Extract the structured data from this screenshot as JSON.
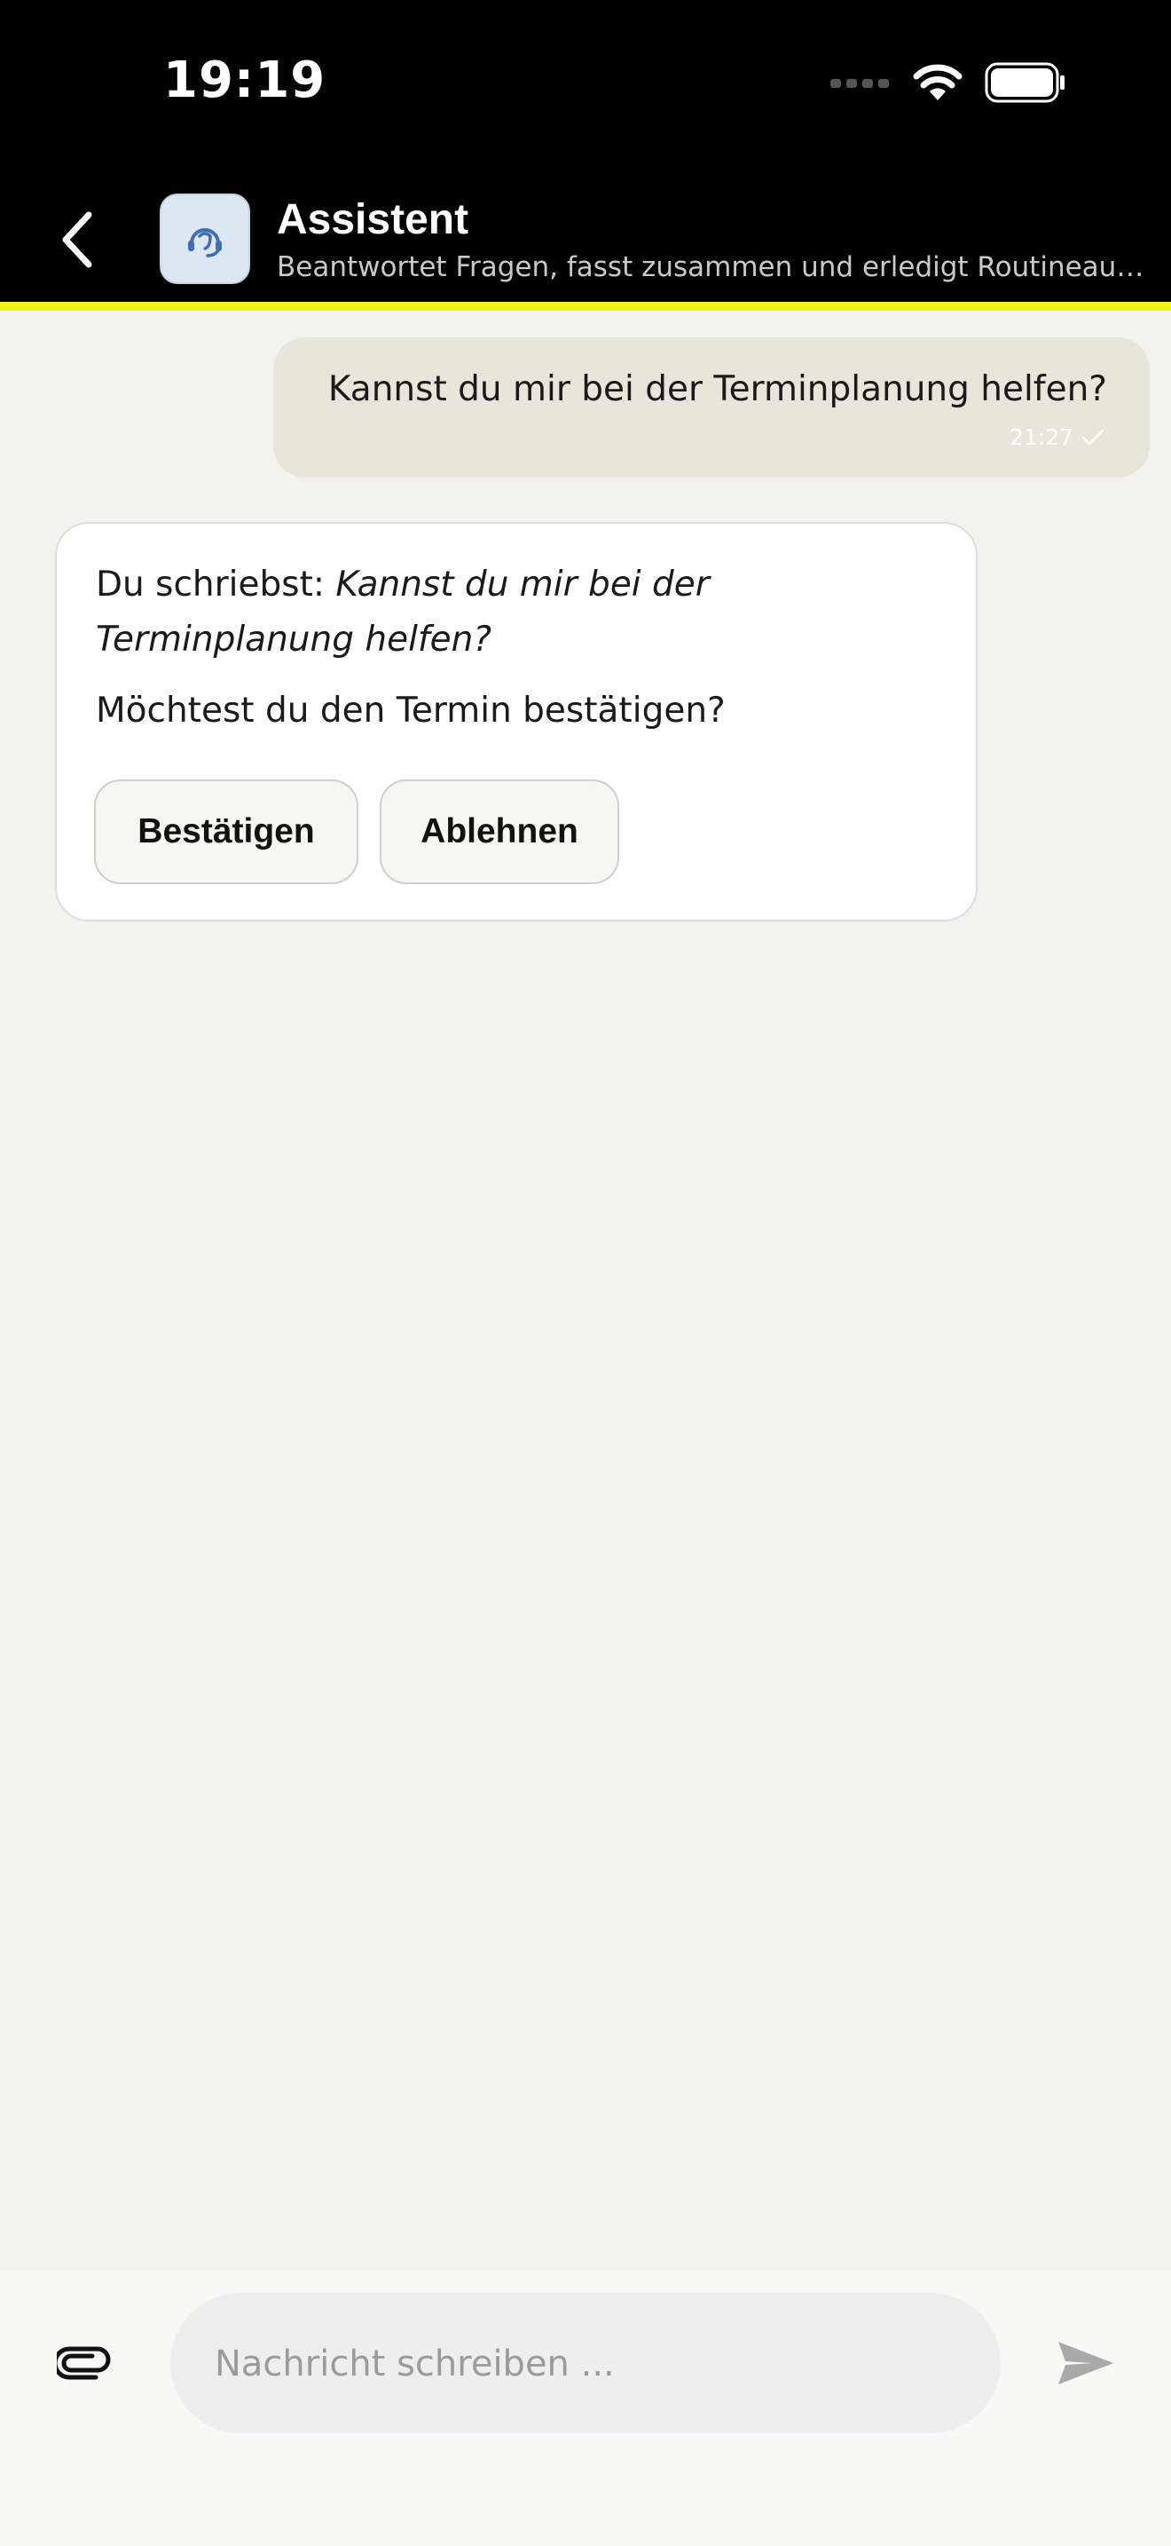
{
  "status_bar": {
    "time": "19:19",
    "signal_icon": "cellular-signal-icon",
    "wifi_icon": "wifi-icon",
    "battery_icon": "battery-icon"
  },
  "header": {
    "back_icon": "chevron-left-icon",
    "avatar_icon": "assistant-headset-icon",
    "title": "Assistent",
    "subtitle": "Beantwortet Fragen, fasst zusammen und erledigt Routineaufgaben",
    "accent_color": "#f1ef1c"
  },
  "messages": {
    "user": {
      "text": "Kannst du mir bei der Terminplanung helfen?",
      "time": "21:27",
      "status_icon": "checkmark-icon"
    },
    "bot": {
      "prefix": "Du schriebst: ",
      "quote": "Kannst du mir bei der Terminplanung helfen?",
      "question": "Möchtest du den Termin bestätigen?",
      "confirm_label": "Bestätigen",
      "decline_label": "Ablehnen"
    }
  },
  "composer": {
    "attach_icon": "paperclip-icon",
    "placeholder": "Nachricht schreiben ...",
    "value": "",
    "send_icon": "send-icon"
  }
}
